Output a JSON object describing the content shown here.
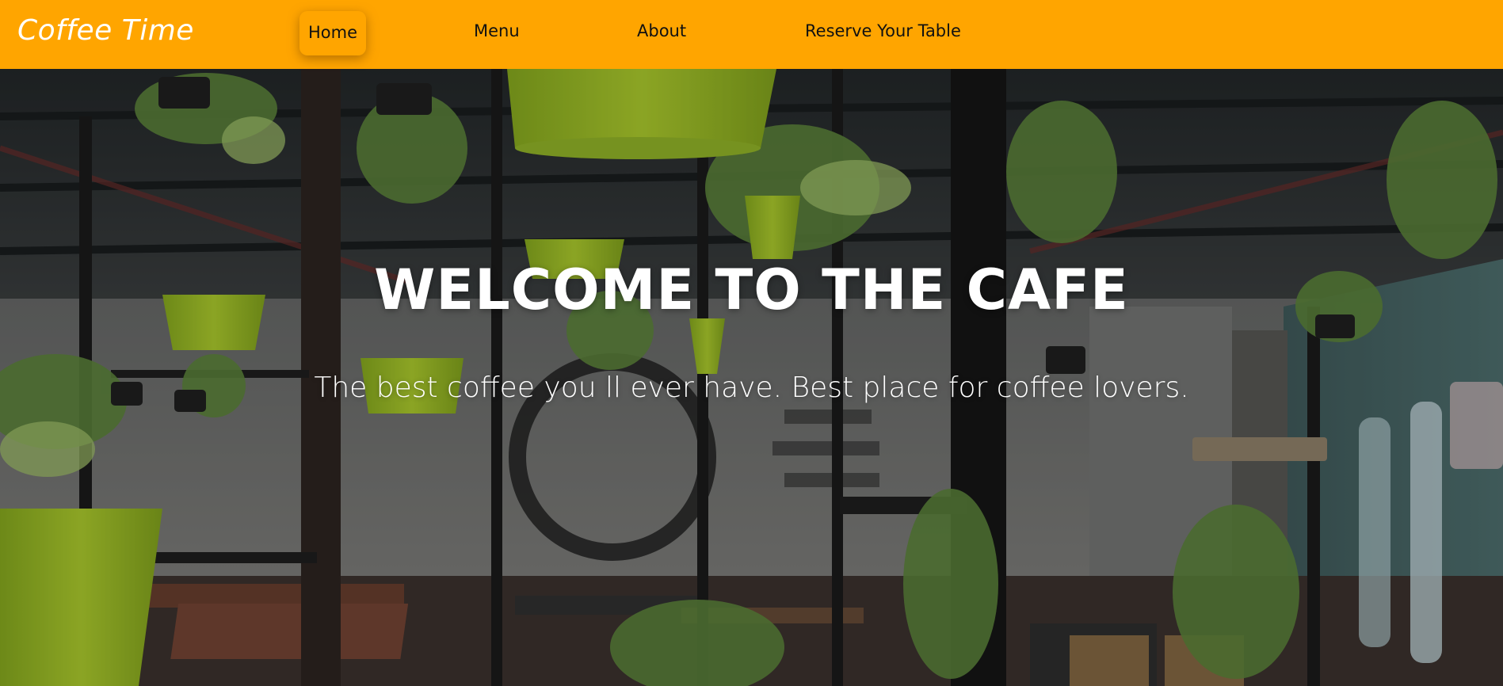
{
  "nav": {
    "brand": "Coffee Time",
    "links": [
      {
        "label": "Home",
        "active": true
      },
      {
        "label": "Menu",
        "active": false
      },
      {
        "label": "About",
        "active": false
      },
      {
        "label": "Reserve Your Table",
        "active": false
      }
    ]
  },
  "hero": {
    "title": "WELCOME TO THE CAFE",
    "subtitle": "The best coffee you ll ever have. Best place for coffee lovers."
  },
  "colors": {
    "navbar": "#ffa500",
    "brand_text": "#ffffff",
    "nav_text": "#111111",
    "hero_text": "#ffffff"
  }
}
